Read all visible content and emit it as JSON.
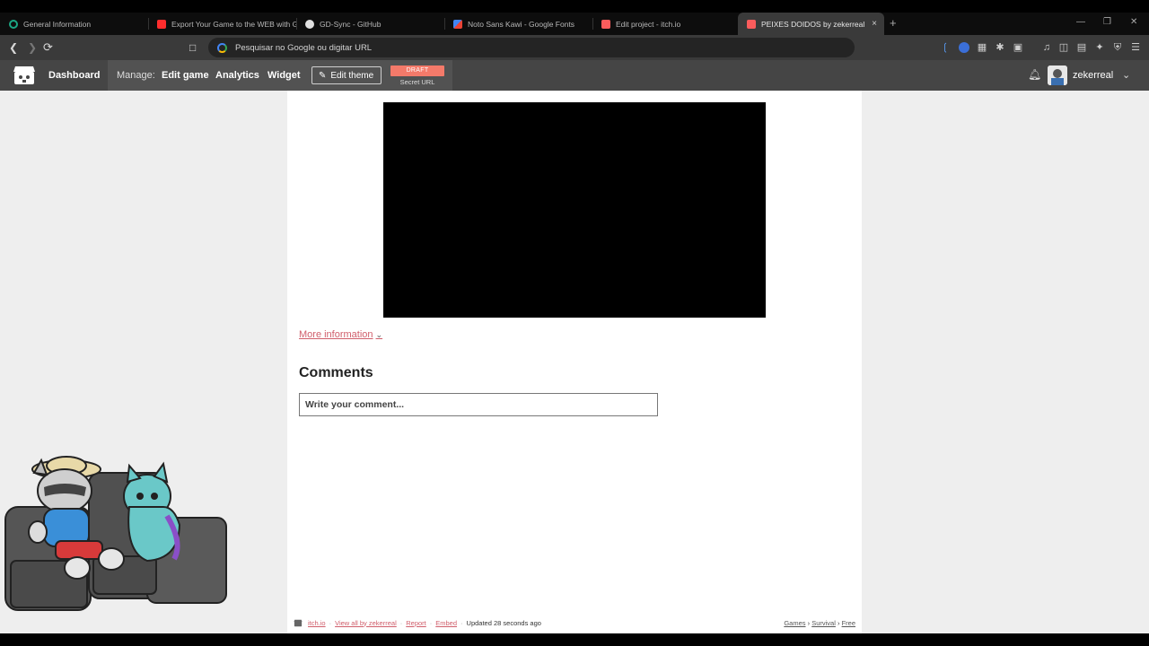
{
  "browser": {
    "tabs": [
      {
        "title": "General Information",
        "icon": "circle-icon",
        "color": "#1ba784"
      },
      {
        "title": "Export Your Game to the WEB with G",
        "icon": "youtube-icon",
        "color": "#ff2d2d"
      },
      {
        "title": "GD-Sync - GitHub",
        "icon": "github-icon",
        "color": "#e0e0e0"
      },
      {
        "title": "Noto Sans Kawi - Google Fonts",
        "icon": "google-fonts-icon",
        "color": "#4285f4"
      },
      {
        "title": "Edit project - itch.io",
        "icon": "itch-icon",
        "color": "#fa5c5c"
      },
      {
        "title": "PEIXES DOIDOS by zekerreal",
        "icon": "itch-icon",
        "color": "#fa5c5c"
      }
    ],
    "new_tab_glyph": "+",
    "tab_close_glyph": "×",
    "omnibox_placeholder": "Pesquisar no Google ou digitar URL"
  },
  "itch_header": {
    "dashboard": "Dashboard",
    "manage_label": "Manage:",
    "edit_game": "Edit game",
    "analytics": "Analytics",
    "widget": "Widget",
    "edit_theme": "Edit theme",
    "draft_badge": "DRAFT",
    "secret_url": "Secret URL",
    "username": "zekerreal",
    "accent_color": "#f47a6a"
  },
  "page": {
    "more_information": "More information",
    "comments_heading": "Comments",
    "comment_placeholder": "Write your comment...",
    "link_color": "#d05e6b"
  },
  "footer": {
    "itch": "itch.io",
    "view_all": "View all by zekerreal",
    "report": "Report",
    "embed": "Embed",
    "updated": "Updated 28 seconds ago",
    "breadcrumb": [
      "Games",
      "Survival",
      "Free"
    ],
    "separator": "·",
    "crumb_separator": "›"
  }
}
